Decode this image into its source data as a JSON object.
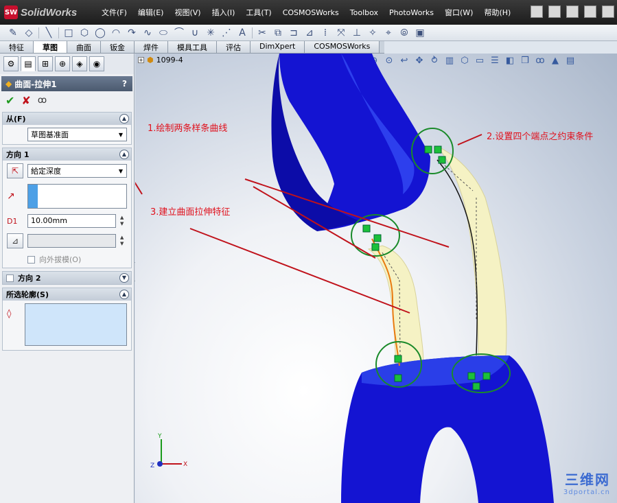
{
  "app": {
    "name": "SolidWorks",
    "logo_mark": "SW"
  },
  "menu": [
    "文件(F)",
    "编辑(E)",
    "视图(V)",
    "插入(I)",
    "工具(T)",
    "COSMOSWorks",
    "Toolbox",
    "PhotoWorks",
    "窗口(W)",
    "帮助(H)"
  ],
  "tabs": [
    {
      "label": "特征",
      "active": false
    },
    {
      "label": "草图",
      "active": true
    },
    {
      "label": "曲面",
      "active": false
    },
    {
      "label": "钣金",
      "active": false
    },
    {
      "label": "焊件",
      "active": false
    },
    {
      "label": "模具工具",
      "active": false
    },
    {
      "label": "评估",
      "active": false
    },
    {
      "label": "DimXpert",
      "active": false
    },
    {
      "label": "COSMOSWorks",
      "active": false
    }
  ],
  "property_manager": {
    "title": "曲面-拉伸1",
    "help": "?",
    "from": {
      "header": "从(F)",
      "value": "草图基准面"
    },
    "direction1": {
      "header": "方向 1",
      "end_condition": "給定深度",
      "depth": "10.00mm",
      "draft_outward": "向外拔模(O)"
    },
    "direction2": {
      "header": "方向 2"
    },
    "contours": {
      "header": "所选轮廓(S)"
    }
  },
  "viewport": {
    "part_name": "1099-4",
    "annotations": {
      "a1": "1.绘制两条样条曲线",
      "a2": "2.设置四个端点之约束条件",
      "a3": "3.建立曲面拉伸特征"
    },
    "triad": {
      "x": "X",
      "y": "Y",
      "z": "Z"
    },
    "watermark_main": "三维网",
    "watermark_sub": "3dportal.cn"
  },
  "colors": {
    "tube_blue": "#1414d2",
    "surface_yellow": "#f5f2c4",
    "annotation_red": "#e0101c",
    "constraint_green": "#1a8a2a"
  }
}
